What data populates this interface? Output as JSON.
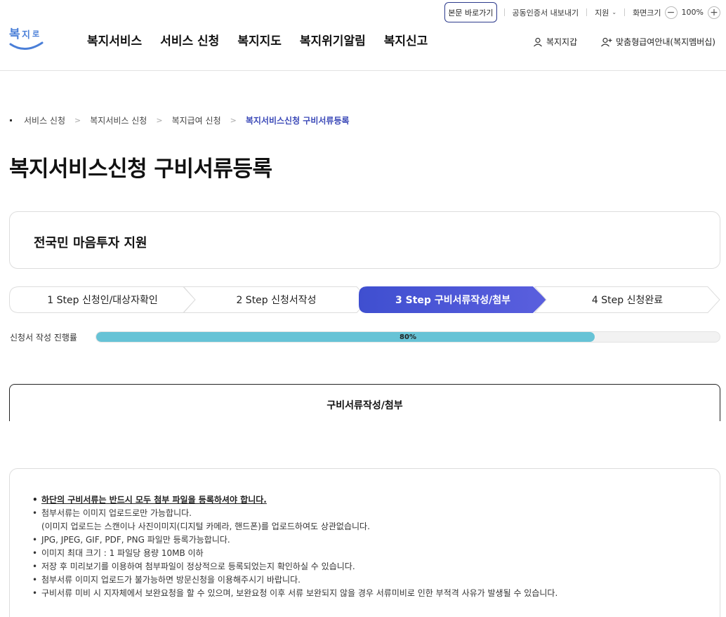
{
  "util": {
    "skip": "본문 바로가기",
    "cert": "공동인증서 내보내기",
    "support": "지원",
    "zoom_label": "화면크기",
    "zoom_value": "100%",
    "zoom_out": "−",
    "zoom_in": "+"
  },
  "logo": {
    "text": "복지로"
  },
  "gnb": [
    "복지서비스",
    "서비스 신청",
    "복지지도",
    "복지위기알림",
    "복지신고"
  ],
  "member": {
    "wallet": "복지지갑",
    "membership": "맞춤형급여안내(복지멤버십)"
  },
  "breadcrumb": [
    "서비스 신청",
    "복지서비스 신청",
    "복지급여 신청",
    "복지서비스신청 구비서류등록"
  ],
  "page_title": "복지서비스신청 구비서류등록",
  "service_name": "전국민 마음투자 지원",
  "steps": [
    {
      "label": "1 Step 신청인/대상자확인",
      "active": false
    },
    {
      "label": "2 Step 신청서작성",
      "active": false
    },
    {
      "label": "3 Step 구비서류작성/첨부",
      "active": true
    },
    {
      "label": "4 Step 신청완료",
      "active": false
    }
  ],
  "progress": {
    "label": "신청서 작성 진행률",
    "value": 80,
    "text": "80%",
    "color": "#67c3d6"
  },
  "doc_section_title": "구비서류작성/첨부",
  "notice": {
    "items": [
      "하단의 구비서류는 반드시 모두 첨부 파일을 등록하셔야 합니다.",
      "첨부서류는 이미지 업로드로만 가능합니다.",
      "(이미지 업로드는 스캔이나 사진이미지(디지털 카메라, 핸드폰)를 업로드하여도 상관없습니다.",
      "JPG, JPEG, GIF, PDF, PNG 파일만 등록가능합니다.",
      "이미지 최대 크기 : 1 파일당 용량 10MB 이하",
      "저장 후 미리보기를 이용하여 첨부파일이 정상적으로 등록되었는지 확인하실 수 있습니다.",
      "첨부서류 이미지 업로드가 불가능하면 방문신청을 이용해주시기 바랍니다.",
      "구비서류 미비 시 지자체에서 보완요청을 할 수 있으며, 보완요청 이후 서류 보완되지 않을 경우 서류미비로 인한 부적격 사유가 발생될 수 있습니다."
    ]
  },
  "colors": {
    "accent": "#4a56d6",
    "brand_navy": "#2c3a8c",
    "breadcrumb_current": "#3b49b8"
  }
}
